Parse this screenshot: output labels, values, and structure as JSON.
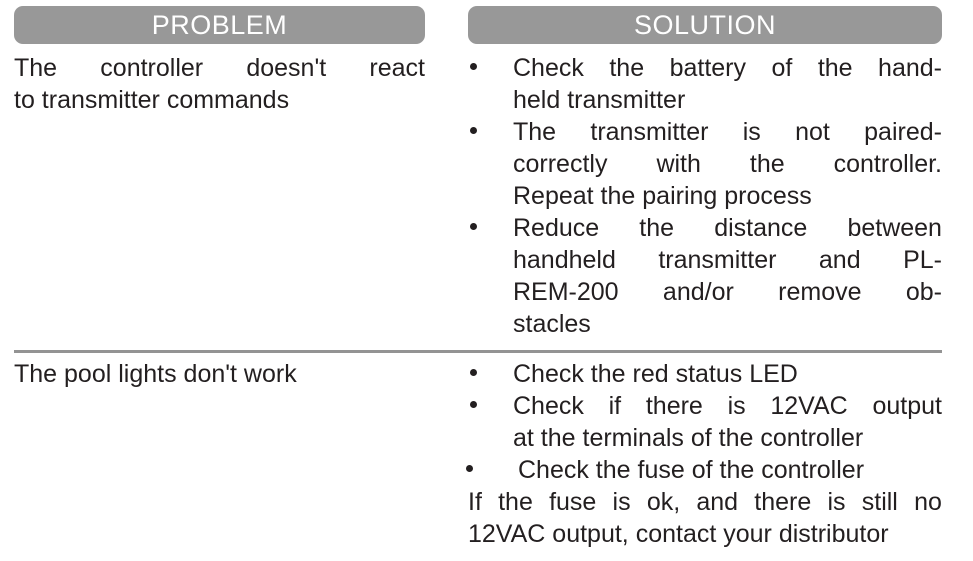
{
  "table": {
    "headers": {
      "problem": "PROBLEM",
      "solution": "SOLUTION"
    },
    "header_bg_color": "#989898",
    "header_text_color": "#ffffff",
    "divider_color": "#939393",
    "body_text_color": "#231f20",
    "rows": [
      {
        "problem": "The controller doesn't react to transmitter commands",
        "problem_lines": [
          [
            "The",
            "controller",
            "doesn't",
            "react"
          ],
          [
            "to transmitter commands"
          ]
        ],
        "solutions": [
          {
            "text": "Check the battery of the handheld transmitter",
            "lines": [
              [
                "Check",
                "the",
                "battery",
                "of",
                "the",
                "hand-"
              ],
              [
                "held transmitter"
              ]
            ]
          },
          {
            "text": "The transmitter is not paired-correctly with the controller. Repeat the pairing process",
            "lines": [
              [
                "The",
                "transmitter",
                "is",
                "not",
                "paired-"
              ],
              [
                "correctly",
                "with",
                "the",
                "controller."
              ],
              [
                "Repeat the pairing process"
              ]
            ]
          },
          {
            "text": "Reduce the distance between handheld transmitter and PL-REM-200 and/or remove obstacles",
            "lines": [
              [
                "Reduce",
                "the",
                "distance",
                "between"
              ],
              [
                "handheld",
                "transmitter",
                "and",
                "PL-"
              ],
              [
                "REM-200",
                "and/or",
                "remove",
                "ob-"
              ],
              [
                "stacles"
              ]
            ]
          }
        ],
        "note": null
      },
      {
        "problem": "The pool lights don't work",
        "problem_lines": [
          [
            "The pool lights don't work"
          ]
        ],
        "solutions": [
          {
            "text": "Check the red status LED",
            "lines": [
              [
                "Check the red status LED"
              ]
            ]
          },
          {
            "text": "Check if there is 12VAC output at the terminals of the controller",
            "lines": [
              [
                "Check",
                "if",
                "there",
                "is",
                "12VAC",
                "output"
              ],
              [
                "at the terminals of the controller"
              ]
            ]
          },
          {
            "text": "Check the fuse of the controller",
            "lines": [
              [
                "Check the fuse of the controller"
              ]
            ]
          }
        ],
        "note": {
          "text": "If the fuse is ok, and there is still no 12VAC output, contact your distributor",
          "lines": [
            [
              "If",
              "the",
              "fuse",
              "is",
              "ok,",
              "and",
              "there",
              "is",
              "still",
              "no"
            ],
            [
              "12VAC output, contact your distributor"
            ]
          ]
        }
      }
    ]
  }
}
